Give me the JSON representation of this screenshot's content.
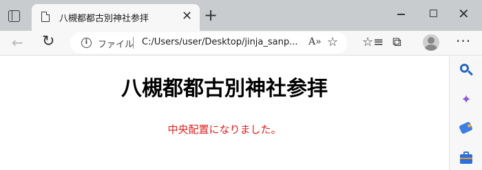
{
  "browser": {
    "tab": {
      "title": "八槻都都古別神社参拝",
      "close_glyph": "✕"
    },
    "new_tab_glyph": "+",
    "window_controls": {
      "close_glyph": "✕"
    },
    "toolbar": {
      "back_glyph": "←",
      "reload_glyph": "↻",
      "address": {
        "protocol_label": "ファイル",
        "url": "C:/Users/user/Desktop/jinja_sanp..."
      },
      "read_aloud_glyph": "A»",
      "favorite_add_glyph": "☆",
      "favorites_glyph": "☆≡",
      "collections_glyph": "⧉",
      "more_glyph": "···"
    }
  },
  "page": {
    "title": "八槻都都古別神社参拝",
    "message": "中央配置になりました。",
    "message_color": "#e0201e"
  },
  "sidebar": {
    "icons": [
      "search-icon",
      "copilot-icon",
      "shopping-tag-icon",
      "tools-briefcase-icon"
    ],
    "copilot_glyph": "✦"
  }
}
